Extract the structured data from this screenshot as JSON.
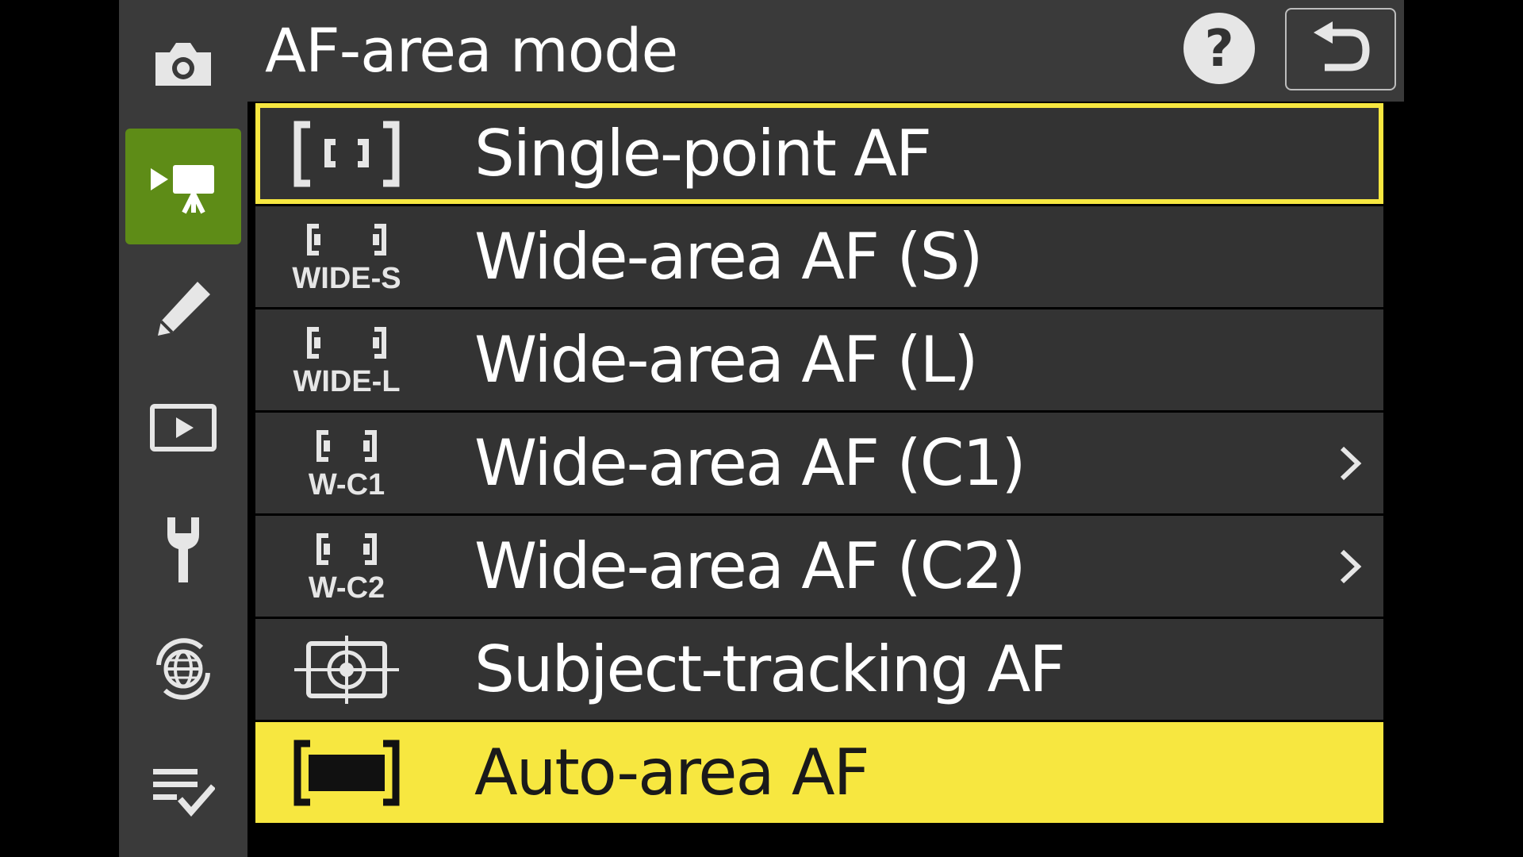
{
  "menu": {
    "title": "AF-area mode",
    "help_label": "?",
    "items": [
      {
        "label": "Single-point AF",
        "icon": "single-point-af-icon",
        "state": "selected",
        "submenu": false
      },
      {
        "label": "Wide-area AF (S)",
        "icon": "wide-area-s-icon",
        "icon_text": "WIDE-S",
        "state": "normal",
        "submenu": false
      },
      {
        "label": "Wide-area AF (L)",
        "icon": "wide-area-l-icon",
        "icon_text": "WIDE-L",
        "state": "normal",
        "submenu": false
      },
      {
        "label": "Wide-area AF (C1)",
        "icon": "wide-area-c1-icon",
        "icon_text": "W-C1",
        "state": "normal",
        "submenu": true
      },
      {
        "label": "Wide-area AF (C2)",
        "icon": "wide-area-c2-icon",
        "icon_text": "W-C2",
        "state": "normal",
        "submenu": true
      },
      {
        "label": "Subject-tracking AF",
        "icon": "subject-tracking-af-icon",
        "state": "normal",
        "submenu": false
      },
      {
        "label": "Auto-area AF",
        "icon": "auto-area-af-icon",
        "state": "highlighted",
        "submenu": false
      }
    ]
  },
  "sidebar": {
    "items": [
      {
        "icon": "camera-icon",
        "active": false
      },
      {
        "icon": "video-camera-icon",
        "active": true
      },
      {
        "icon": "pencil-icon",
        "active": false
      },
      {
        "icon": "playback-icon",
        "active": false
      },
      {
        "icon": "wrench-icon",
        "active": false
      },
      {
        "icon": "network-icon",
        "active": false
      },
      {
        "icon": "my-menu-icon",
        "active": false
      }
    ]
  },
  "colors": {
    "accent_yellow": "#f7e740",
    "active_green": "#5e8c17",
    "panel": "#3a3a3a",
    "row": "#333333"
  }
}
